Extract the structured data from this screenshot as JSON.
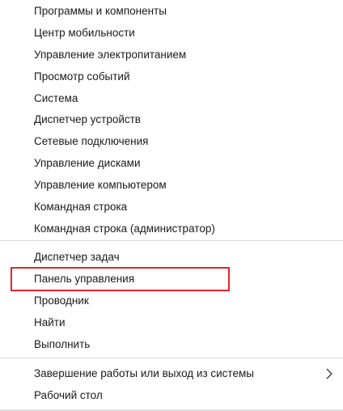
{
  "menu": {
    "items": [
      "Программы и компоненты",
      "Центр мобильности",
      "Управление электропитанием",
      "Просмотр событий",
      "Система",
      "Диспетчер устройств",
      "Сетевые подключения",
      "Управление дисками",
      "Управление компьютером",
      "Командная строка",
      "Командная строка (администратор)",
      "Диспетчер задач",
      "Панель управления",
      "Проводник",
      "Найти",
      "Выполнить",
      "Завершение работы или выход из системы",
      "Рабочий стол"
    ],
    "highlighted_item": "Панель управления",
    "highlight_color": "#e0262d",
    "submenu_icon": "chevron-right-icon"
  }
}
